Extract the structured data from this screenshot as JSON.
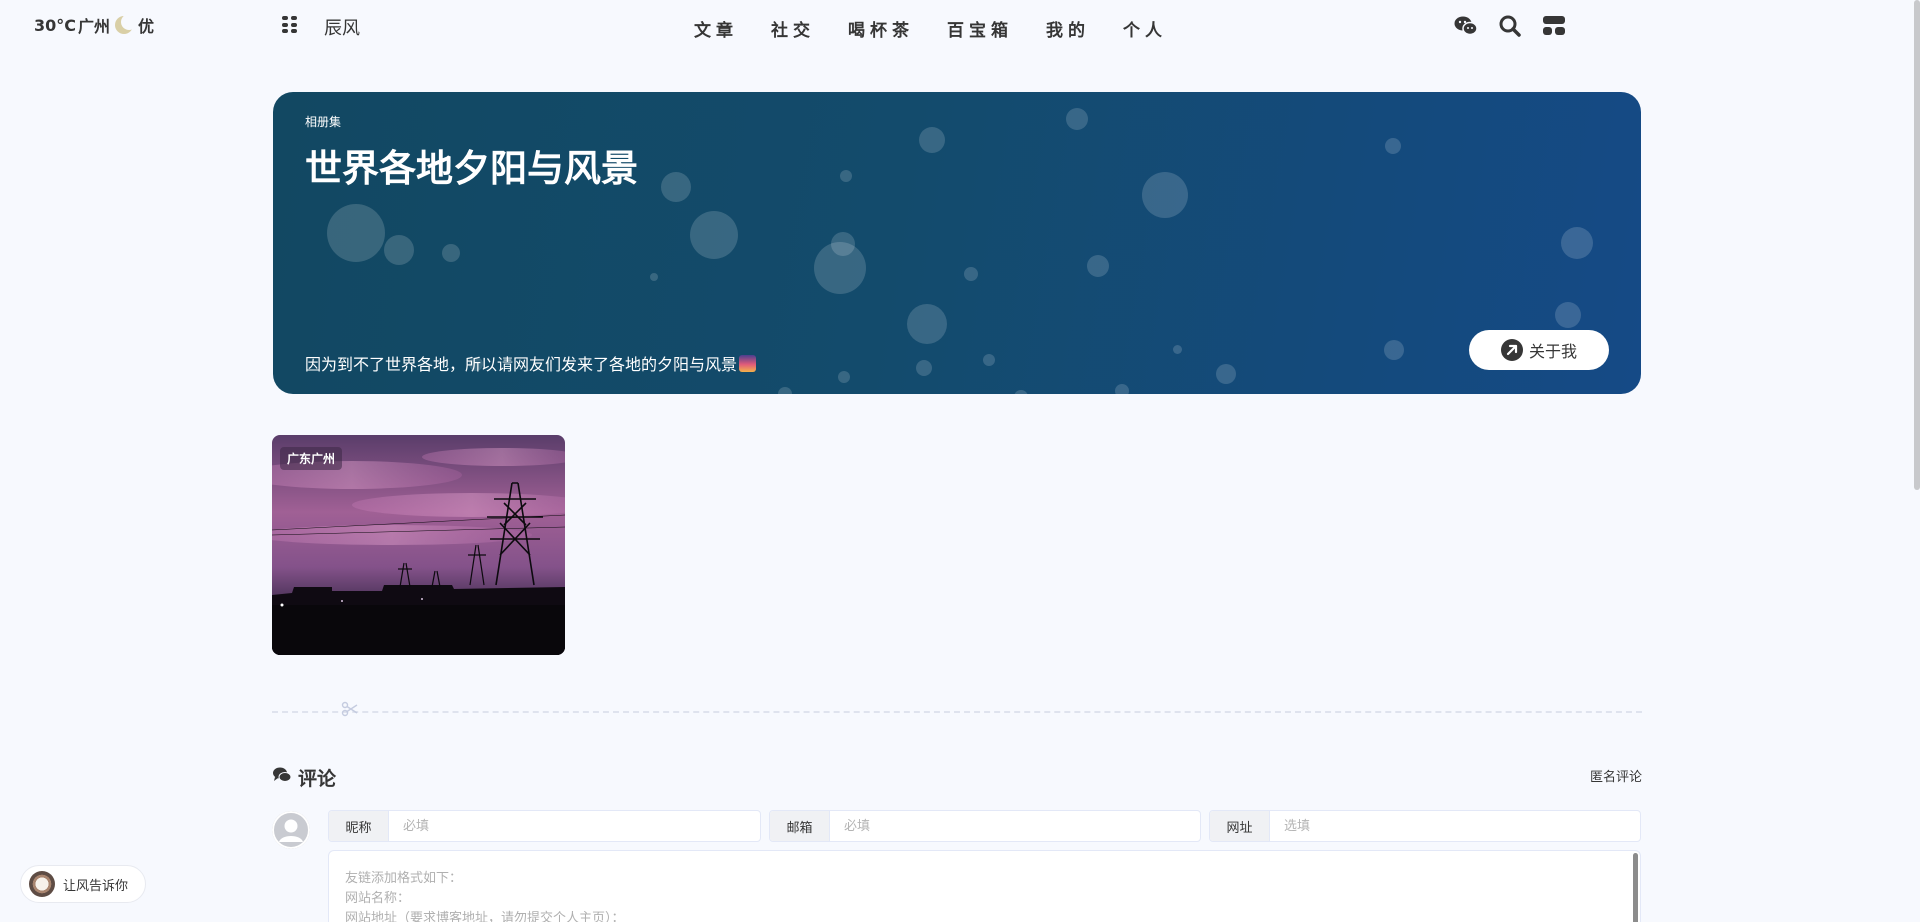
{
  "topbar": {
    "weather": {
      "temp": "30°C",
      "city": "广州",
      "air": "优"
    },
    "site_name": "辰风",
    "nav": [
      "文章",
      "社交",
      "喝杯茶",
      "百宝箱",
      "我的",
      "个人"
    ],
    "right_icons": [
      "wechat-icon",
      "search-icon",
      "console-icon"
    ]
  },
  "hero": {
    "tag": "相册集",
    "title": "世界各地夕阳与风景",
    "description": "因为到不了世界各地，所以请网友们发来了各地的夕阳与风景",
    "about_label": "关于我",
    "colors": {
      "start": "#124862",
      "end": "#154a86"
    }
  },
  "photos": [
    {
      "location": "广东广州"
    }
  ],
  "comments": {
    "title": "评论",
    "anonymous_link": "匿名评论",
    "fields": {
      "nickname": {
        "label": "昵称",
        "placeholder": "必填"
      },
      "email": {
        "label": "邮箱",
        "placeholder": "必填"
      },
      "website": {
        "label": "网址",
        "placeholder": "选填"
      }
    },
    "textarea_lines": [
      "友链添加格式如下：",
      "网站名称：",
      "网站地址（要求博客地址，请勿提交个人主页）："
    ]
  },
  "chat_widget": {
    "label": "让风告诉你"
  }
}
